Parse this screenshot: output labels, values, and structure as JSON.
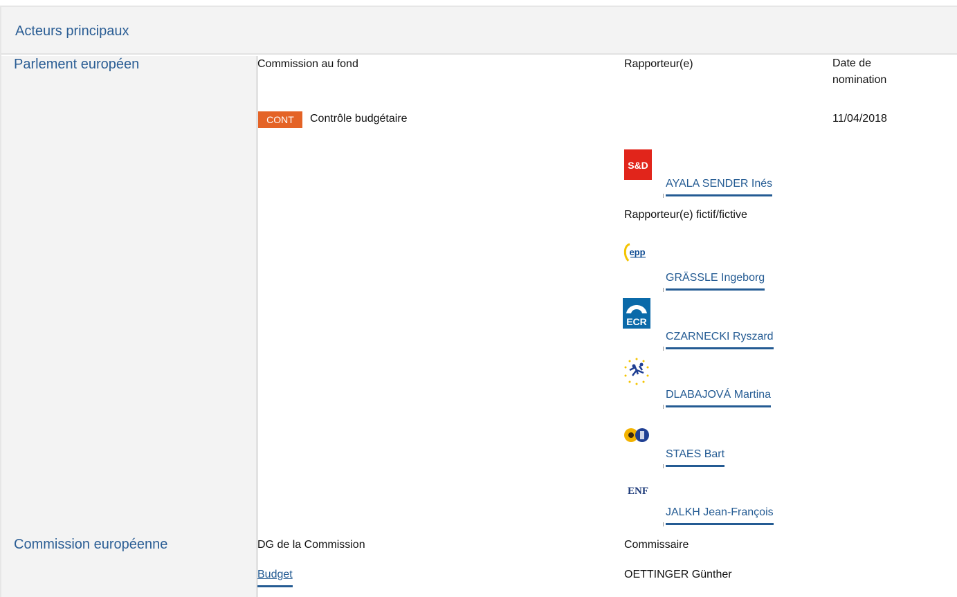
{
  "header": {
    "title": "Acteurs principaux"
  },
  "parliament": {
    "title": "Parlement européen",
    "col_committee": "Commission au fond",
    "col_rapporteur": "Rapporteur(e)",
    "col_date": "Date de nomination",
    "committee_code": "CONT",
    "committee_name": "Contrôle budgétaire",
    "nomination_date": "11/04/2018",
    "rapporteur": {
      "group_logo": "S&D",
      "name": "AYALA SENDER Inés"
    },
    "shadow_label": "Rapporteur(e) fictif/fictive",
    "shadows": [
      {
        "group_logo": "epp",
        "name": "GRÄSSLE Ingeborg"
      },
      {
        "group_logo": "ECR",
        "name": "CZARNECKI Ryszard"
      },
      {
        "group_logo": "alde-logo",
        "name": "DLABAJOVÁ Martina"
      },
      {
        "group_logo": "greens-efa-logo",
        "name": "STAES Bart"
      },
      {
        "group_logo": "ENF",
        "name": "JALKH Jean-François"
      }
    ]
  },
  "commission": {
    "title": "Commission européenne",
    "col_dg": "DG de la Commission",
    "col_commissioner": "Commissaire",
    "dg_name": "Budget",
    "commissioner": "OETTINGER Günther"
  },
  "colors": {
    "accent": "#245b93",
    "badge": "#e46326",
    "panel": "#f3f3f3"
  }
}
